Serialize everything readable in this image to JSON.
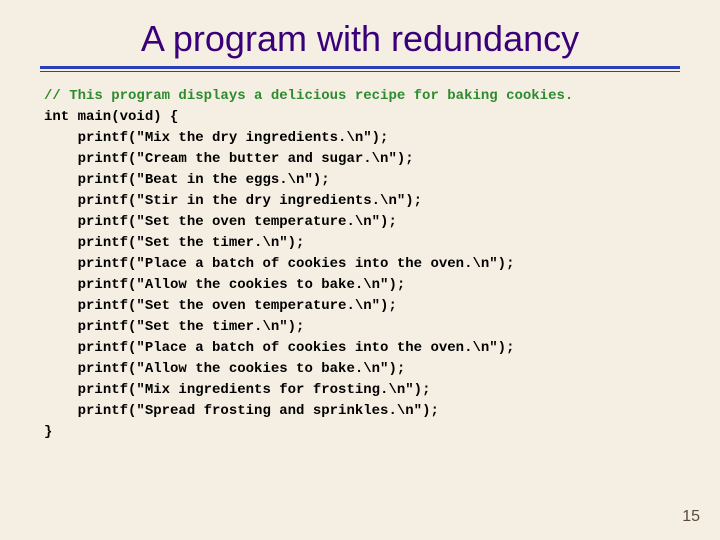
{
  "title": "A program with redundancy",
  "code": {
    "comment": "// This program displays a delicious recipe for baking cookies.",
    "sig": "int main(void) {",
    "lines": [
      "printf(\"Mix the dry ingredients.\\n\");",
      "printf(\"Cream the butter and sugar.\\n\");",
      "printf(\"Beat in the eggs.\\n\");",
      "printf(\"Stir in the dry ingredients.\\n\");",
      "printf(\"Set the oven temperature.\\n\");",
      "printf(\"Set the timer.\\n\");",
      "printf(\"Place a batch of cookies into the oven.\\n\");",
      "printf(\"Allow the cookies to bake.\\n\");",
      "printf(\"Set the oven temperature.\\n\");",
      "printf(\"Set the timer.\\n\");",
      "printf(\"Place a batch of cookies into the oven.\\n\");",
      "printf(\"Allow the cookies to bake.\\n\");",
      "printf(\"Mix ingredients for frosting.\\n\");",
      "printf(\"Spread frosting and sprinkles.\\n\");"
    ],
    "close": "}"
  },
  "page_number": "15"
}
